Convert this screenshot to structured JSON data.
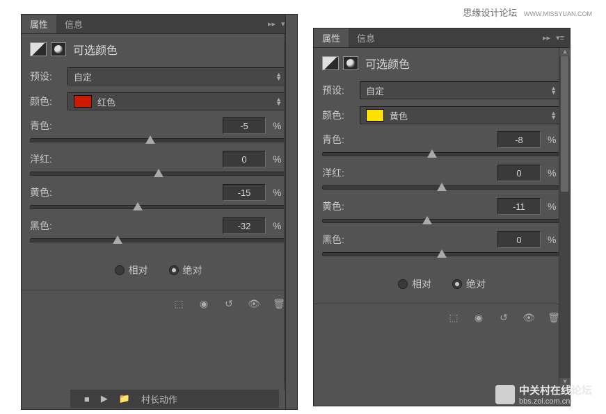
{
  "watermark": {
    "top_main": "思缘设计论坛",
    "top_sub": "WWW.MISSYUAN.COM",
    "bottom_main": "中关村在线论坛",
    "bottom_sub": "bbs.zol.com.cn"
  },
  "tabs": {
    "properties": "属性",
    "info": "信息"
  },
  "panel_title": "可选颜色",
  "labels": {
    "preset": "预设:",
    "color": "颜色:",
    "cyan": "青色:",
    "magenta": "洋红:",
    "yellow": "黄色:",
    "black": "黑色:",
    "pct": "%",
    "relative": "相对",
    "absolute": "绝对"
  },
  "action_label": "村长动作",
  "panels": [
    {
      "id": "left",
      "preset": "自定",
      "color_name": "红色",
      "swatch_class": "red",
      "sliders": [
        {
          "key": "cyan",
          "value": "-5",
          "pos": 47
        },
        {
          "key": "magenta",
          "value": "0",
          "pos": 50
        },
        {
          "key": "yellow",
          "value": "-15",
          "pos": 42
        },
        {
          "key": "black",
          "value": "-32",
          "pos": 34
        }
      ],
      "mode": "absolute"
    },
    {
      "id": "right",
      "preset": "自定",
      "color_name": "黄色",
      "swatch_class": "yellow",
      "sliders": [
        {
          "key": "cyan",
          "value": "-8",
          "pos": 46
        },
        {
          "key": "magenta",
          "value": "0",
          "pos": 50
        },
        {
          "key": "yellow",
          "value": "-11",
          "pos": 44
        },
        {
          "key": "black",
          "value": "0",
          "pos": 50
        }
      ],
      "mode": "absolute"
    }
  ]
}
